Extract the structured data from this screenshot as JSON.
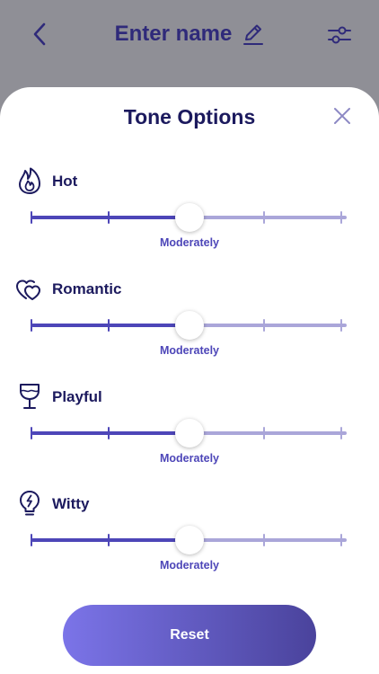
{
  "header": {
    "title": "Enter name",
    "back_icon": "chevron-left-icon",
    "edit_icon": "pencil-icon",
    "filter_icon": "sliders-icon"
  },
  "sheet": {
    "title": "Tone Options",
    "close_icon": "close-icon",
    "tones": [
      {
        "label": "Hot",
        "icon": "flame-icon",
        "level_label": "Moderately",
        "level_fraction": 0.5,
        "steps": 5
      },
      {
        "label": "Romantic",
        "icon": "hearts-icon",
        "level_label": "Moderately",
        "level_fraction": 0.5,
        "steps": 5
      },
      {
        "label": "Playful",
        "icon": "wine-glass-icon",
        "level_label": "Moderately",
        "level_fraction": 0.5,
        "steps": 5
      },
      {
        "label": "Witty",
        "icon": "lightbulb-icon",
        "level_label": "Moderately",
        "level_fraction": 0.5,
        "steps": 5
      }
    ],
    "reset_label": "Reset"
  },
  "colors": {
    "accent": "#4d46b8",
    "accent_light": "#aaa6d9",
    "title_text": "#1c1a5e",
    "header_text": "#2f2a7a",
    "overlay": "#8f8f96",
    "button_gradient_start": "#7b74e8",
    "button_gradient_end": "#4a439c"
  }
}
